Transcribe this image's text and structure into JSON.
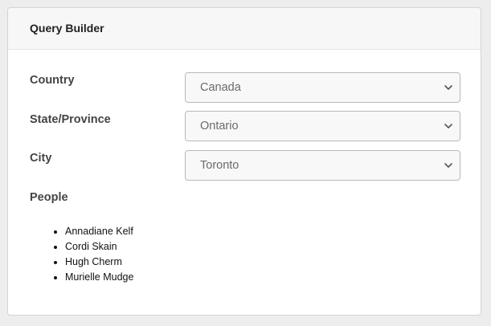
{
  "panel": {
    "title": "Query Builder"
  },
  "fields": {
    "country": {
      "label": "Country",
      "value": "Canada"
    },
    "state": {
      "label": "State/Province",
      "value": "Ontario"
    },
    "city": {
      "label": "City",
      "value": "Toronto"
    }
  },
  "people": {
    "label": "People",
    "items": [
      "Annadiane Kelf",
      "Cordi Skain",
      "Hugh Cherm",
      "Murielle Mudge"
    ]
  },
  "icons": {
    "dropdown": "chevron-down-icon"
  }
}
